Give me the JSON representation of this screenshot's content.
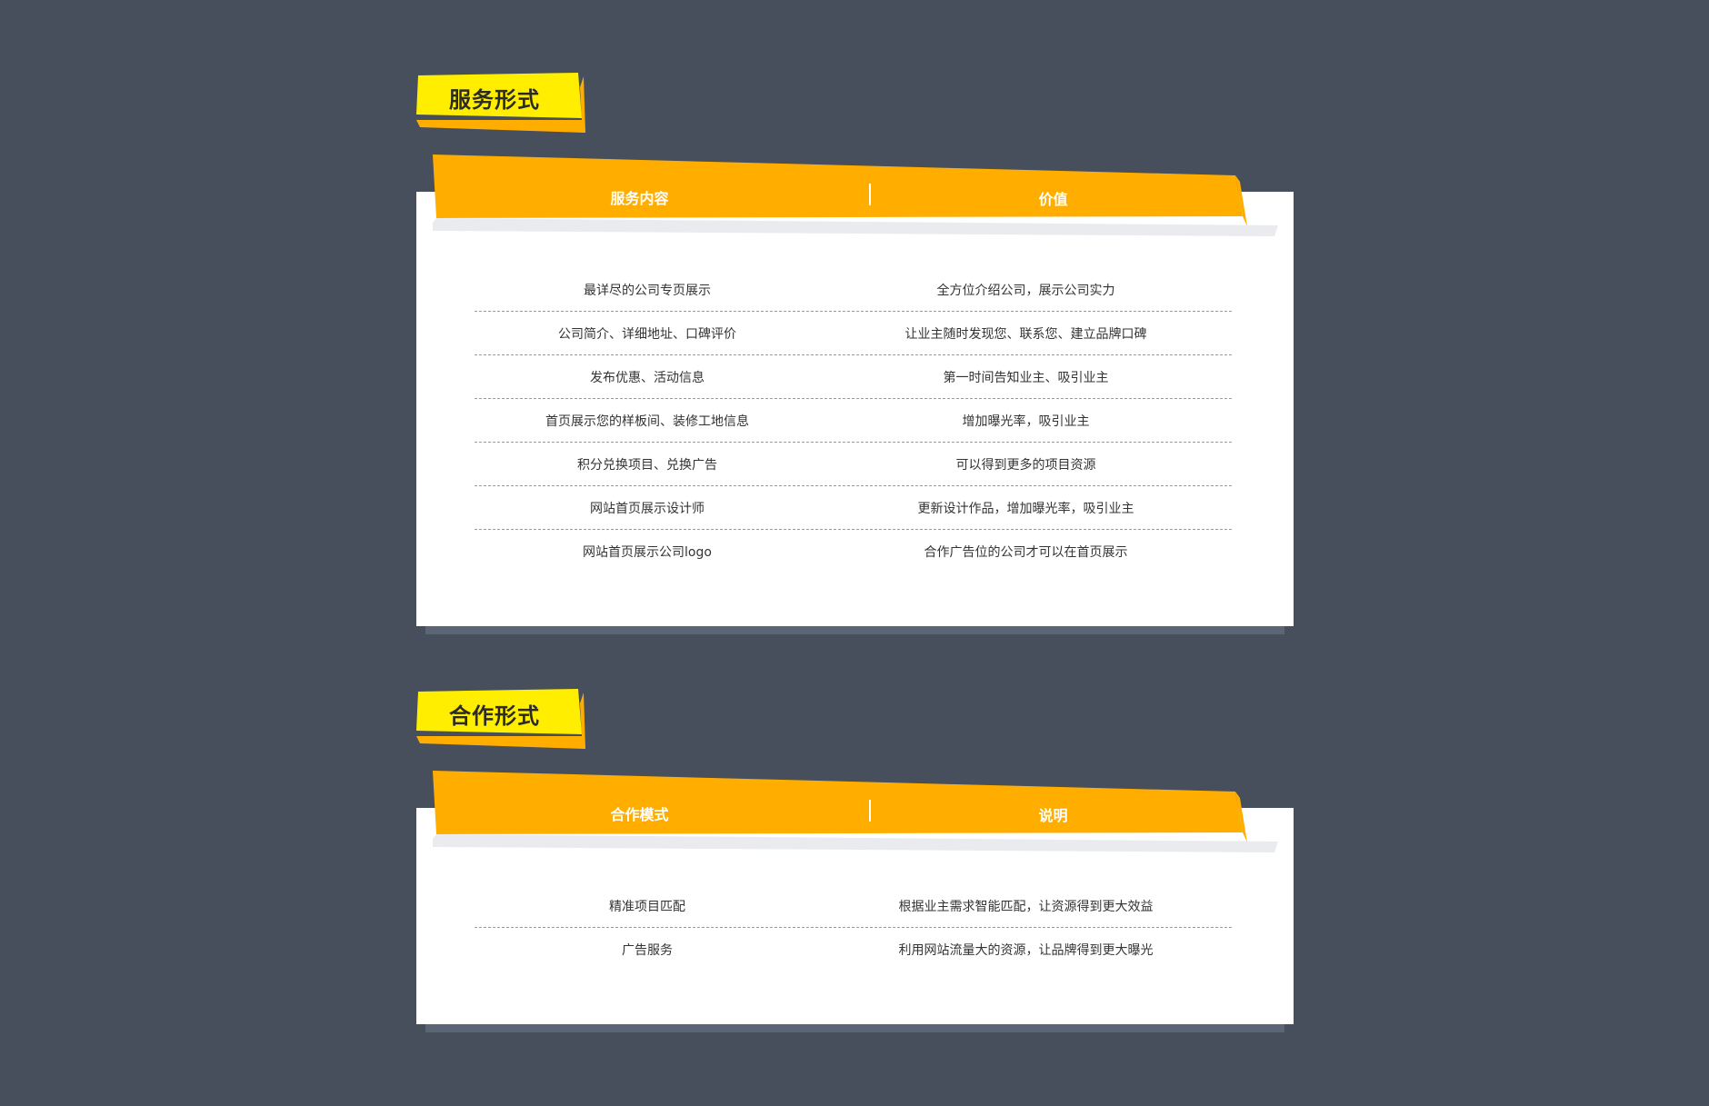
{
  "colors": {
    "background": "#464f5b",
    "badge_yellow": "#ffee00",
    "badge_orange": "#ffae00",
    "header_orange": "#ffae00",
    "card": "#ffffff"
  },
  "service": {
    "label": "服务形式",
    "headers": [
      "服务内容",
      "价值"
    ],
    "rows": [
      {
        "content": "最详尽的公司专页展示",
        "value": "全方位介绍公司，展示公司实力"
      },
      {
        "content": "公司简介、详细地址、口碑评价",
        "value": "让业主随时发现您、联系您、建立品牌口碑"
      },
      {
        "content": "发布优惠、活动信息",
        "value": "第一时间告知业主、吸引业主"
      },
      {
        "content": "首页展示您的样板间、装修工地信息",
        "value": "增加曝光率，吸引业主"
      },
      {
        "content": "积分兑换项目、兑换广告",
        "value": "可以得到更多的项目资源"
      },
      {
        "content": "网站首页展示设计师",
        "value": "更新设计作品，增加曝光率，吸引业主"
      },
      {
        "content": "网站首页展示公司logo",
        "value": "合作广告位的公司才可以在首页展示"
      }
    ]
  },
  "cooperation": {
    "label": "合作形式",
    "headers": [
      "合作模式",
      "说明"
    ],
    "rows": [
      {
        "content": "精准项目匹配",
        "value": "根据业主需求智能匹配，让资源得到更大效益"
      },
      {
        "content": "广告服务",
        "value": "利用网站流量大的资源，让品牌得到更大曝光"
      }
    ]
  }
}
